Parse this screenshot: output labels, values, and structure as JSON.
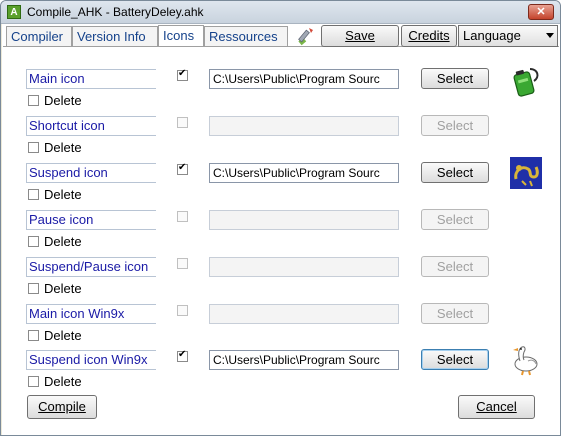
{
  "window": {
    "title": "Compile_AHK - BatteryDeley.ahk",
    "close_glyph": "✕",
    "app_icon_letter": "A"
  },
  "tabs": [
    "Compiler",
    "Version Info",
    "Icons",
    "Ressources"
  ],
  "toolbar": {
    "save_label": "Save",
    "credits_label": "Credits",
    "language_label": "Language"
  },
  "rows": [
    {
      "label": "Main icon",
      "checked": true,
      "path": "C:\\Users\\Public\\Program Sourc",
      "select": "Select",
      "enabled": true,
      "delete_label": "Delete",
      "icon": "battery-icon"
    },
    {
      "label": "Shortcut icon",
      "checked": false,
      "path": "",
      "select": "Select",
      "enabled": false,
      "delete_label": "Delete"
    },
    {
      "label": "Suspend icon",
      "checked": true,
      "path": "C:\\Users\\Public\\Program Sourc",
      "select": "Select",
      "enabled": true,
      "delete_label": "Delete",
      "icon": "dragon-icon"
    },
    {
      "label": "Pause icon",
      "checked": false,
      "path": "",
      "select": "Select",
      "enabled": false,
      "delete_label": "Delete"
    },
    {
      "label": "Suspend/Pause icon",
      "checked": false,
      "path": "",
      "select": "Select",
      "enabled": false,
      "delete_label": "Delete"
    },
    {
      "label": "Main icon Win9x",
      "checked": false,
      "path": "",
      "select": "Select",
      "enabled": false,
      "delete_label": "Delete"
    },
    {
      "label": "Suspend icon Win9x",
      "checked": true,
      "path": "C:\\Users\\Public\\Program Sourc",
      "select": "Select",
      "enabled": true,
      "delete_label": "Delete",
      "icon": "goose-icon"
    }
  ],
  "footer": {
    "compile_label": "Compile",
    "cancel_label": "Cancel"
  },
  "colors": {
    "label_text": "#1a1aa6",
    "tab_text": "#15428b",
    "title_bar": "#c9d3de"
  }
}
